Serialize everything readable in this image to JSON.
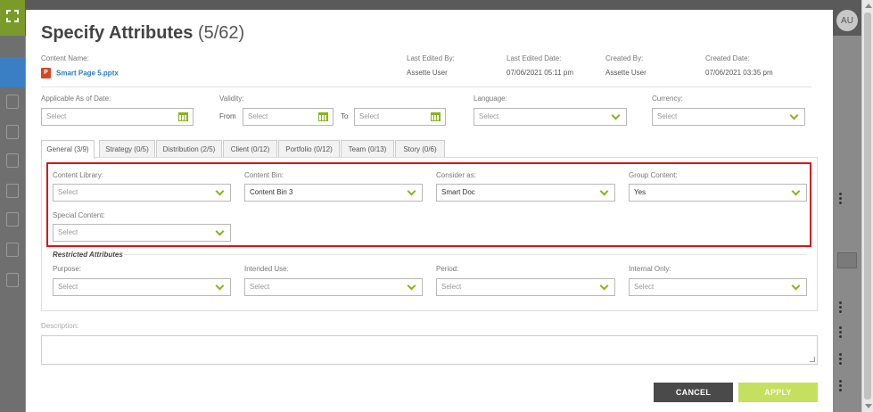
{
  "app": {
    "avatar_initials": "AU"
  },
  "dialog": {
    "title": "Specify Attributes",
    "title_count": "(5/62)",
    "content_name_label": "Content Name:",
    "content_name": "Smart Page 5.pptx",
    "last_edited_by_label": "Last Edited By:",
    "last_edited_by": "Assette User",
    "last_edited_date_label": "Last Edited Date:",
    "last_edited_date": "07/06/2021 05:11 pm",
    "created_by_label": "Created By:",
    "created_by": "Assette User",
    "created_date_label": "Created Date:",
    "created_date": "07/06/2021 03:35 pm"
  },
  "filters": {
    "applicable_label": "Applicable As of Date:",
    "applicable_placeholder": "Select",
    "validity_label": "Validity:",
    "from_label": "From",
    "from_placeholder": "Select",
    "to_label": "To",
    "to_placeholder": "Select",
    "language_label": "Language:",
    "language_placeholder": "Select",
    "currency_label": "Currency:",
    "currency_placeholder": "Select"
  },
  "tabs": [
    {
      "label": "General (3/9)"
    },
    {
      "label": "Strategy (0/5)"
    },
    {
      "label": "Distribution (2/5)"
    },
    {
      "label": "Client (0/12)"
    },
    {
      "label": "Portfolio (0/12)"
    },
    {
      "label": "Team (0/13)"
    },
    {
      "label": "Story (0/6)"
    }
  ],
  "general": {
    "content_library_label": "Content Library:",
    "content_library_value": "Select",
    "content_bin_label": "Content Bin:",
    "content_bin_value": "Content Bin 3",
    "consider_as_label": "Consider as:",
    "consider_as_value": "Smart Doc",
    "group_content_label": "Group Content:",
    "group_content_value": "Yes",
    "special_content_label": "Special Content:",
    "special_content_value": "Select"
  },
  "restricted": {
    "heading": "Restricted Attributes",
    "purpose_label": "Purpose:",
    "purpose_value": "Select",
    "intended_use_label": "Intended Use:",
    "intended_use_value": "Select",
    "period_label": "Period:",
    "period_value": "Select",
    "internal_only_label": "Internal Only:",
    "internal_only_value": "Select"
  },
  "description": {
    "label": "Description:"
  },
  "buttons": {
    "cancel": "CANCEL",
    "apply": "APPLY"
  },
  "colors": {
    "accent_green": "#8ab31c",
    "apply_bg": "#c5e05e",
    "cancel_bg": "#4a4a4a",
    "link_blue": "#2a7bc6",
    "highlight_red": "#d9141c"
  }
}
